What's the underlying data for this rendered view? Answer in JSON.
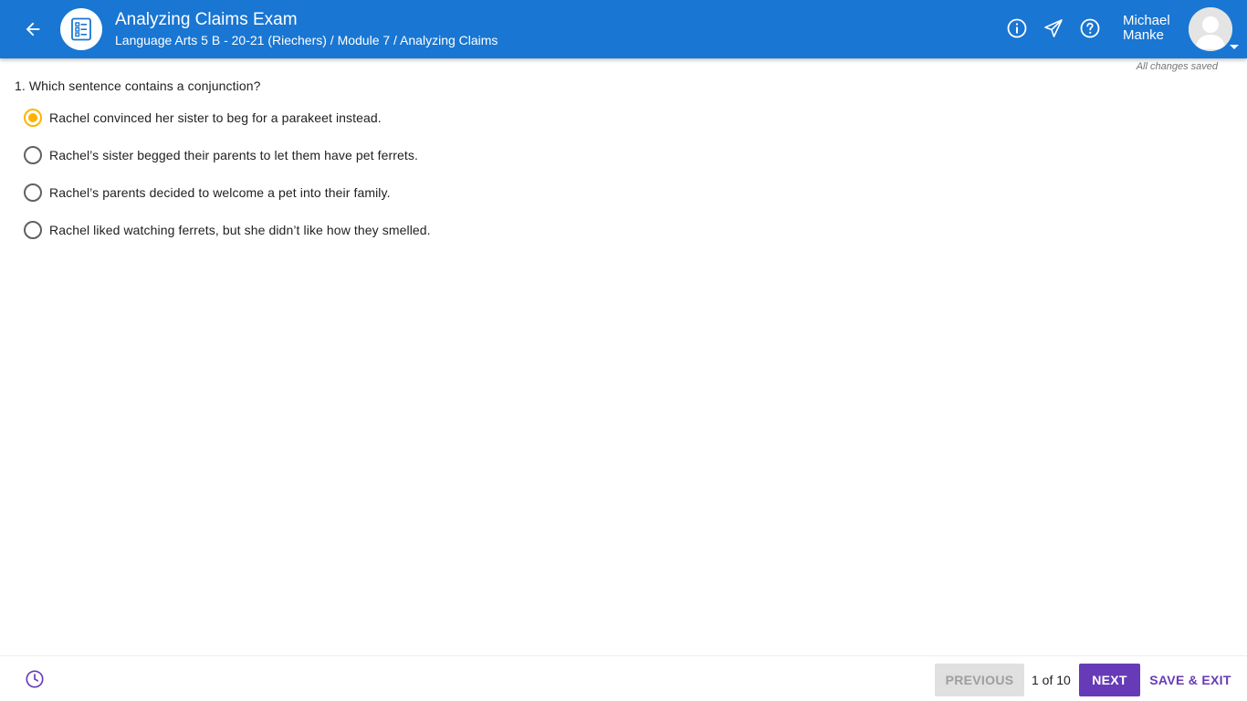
{
  "header": {
    "title": "Analyzing Claims Exam",
    "breadcrumb": "Language Arts 5 B - 20-21 (Riechers) / Module 7 / Analyzing Claims",
    "user_first": "Michael",
    "user_last": "Manke",
    "icons": [
      "back-arrow-icon",
      "checklist-icon",
      "info-icon",
      "send-icon",
      "help-icon",
      "avatar",
      "chevron-down-icon"
    ]
  },
  "status": {
    "saved": "All changes saved"
  },
  "question": {
    "number_text": "1. Which sentence contains a conjunction?",
    "options": [
      {
        "label": "Rachel convinced her sister to beg for a parakeet instead.",
        "selected": true
      },
      {
        "label": "Rachel’s sister begged their parents to let them have pet ferrets.",
        "selected": false
      },
      {
        "label": "Rachel’s parents decided to welcome a pet into their family.",
        "selected": false
      },
      {
        "label": "Rachel liked watching ferrets, but she didn’t like how they smelled.",
        "selected": false
      }
    ]
  },
  "footer": {
    "previous_label": "PREVIOUS",
    "page_indicator": "1 of 10",
    "next_label": "NEXT",
    "save_exit_label": "SAVE & EXIT"
  },
  "colors": {
    "header_bg": "#1976d2",
    "accent_purple": "#673ab7",
    "radio_selected": "#ffb300"
  }
}
